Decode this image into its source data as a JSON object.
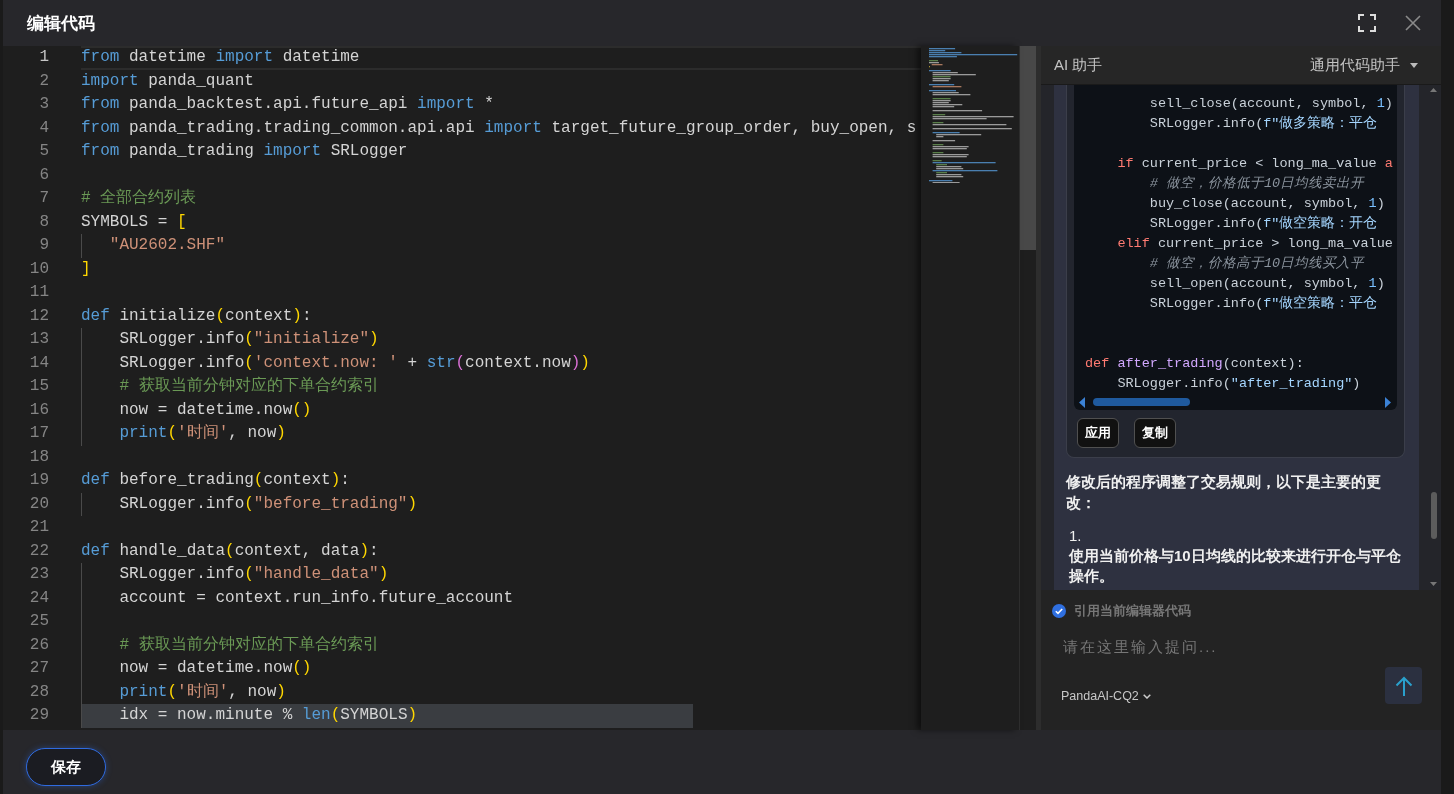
{
  "window": {
    "title": "编辑代码"
  },
  "editor": {
    "lines": [
      {
        "number": "1",
        "current": true,
        "selected": false,
        "indent_guide": false,
        "tokens": [
          {
            "kind": "keyword",
            "text": "from"
          },
          {
            "kind": "plain",
            "text": " datetime "
          },
          {
            "kind": "keyword",
            "text": "import"
          },
          {
            "kind": "plain",
            "text": " datetime"
          }
        ]
      },
      {
        "number": "2",
        "current": false,
        "selected": false,
        "indent_guide": false,
        "tokens": [
          {
            "kind": "keyword",
            "text": "import"
          },
          {
            "kind": "plain",
            "text": " panda_quant"
          }
        ]
      },
      {
        "number": "3",
        "current": false,
        "selected": false,
        "indent_guide": false,
        "tokens": [
          {
            "kind": "keyword",
            "text": "from"
          },
          {
            "kind": "plain",
            "text": " panda_backtest.api.future_api "
          },
          {
            "kind": "keyword",
            "text": "import"
          },
          {
            "kind": "plain",
            "text": " *"
          }
        ]
      },
      {
        "number": "4",
        "current": false,
        "selected": false,
        "indent_guide": false,
        "tokens": [
          {
            "kind": "keyword",
            "text": "from"
          },
          {
            "kind": "plain",
            "text": " panda_trading.trading_common.api.api "
          },
          {
            "kind": "keyword",
            "text": "import"
          },
          {
            "kind": "plain",
            "text": " target_future_group_order, buy_open, s"
          }
        ]
      },
      {
        "number": "5",
        "current": false,
        "selected": false,
        "indent_guide": false,
        "tokens": [
          {
            "kind": "keyword",
            "text": "from"
          },
          {
            "kind": "plain",
            "text": " panda_trading "
          },
          {
            "kind": "keyword",
            "text": "import"
          },
          {
            "kind": "plain",
            "text": " SRLogger"
          }
        ]
      },
      {
        "number": "6",
        "current": false,
        "selected": false,
        "indent_guide": false
      },
      {
        "number": "7",
        "current": false,
        "selected": false,
        "indent_guide": false,
        "tokens": [
          {
            "kind": "comment",
            "text": "# 全部合约列表"
          }
        ]
      },
      {
        "number": "8",
        "current": false,
        "selected": false,
        "indent_guide": false,
        "tokens": [
          {
            "kind": "plain",
            "text": "SYMBOLS = "
          },
          {
            "kind": "bracket",
            "text": "["
          }
        ]
      },
      {
        "number": "9",
        "current": false,
        "selected": false,
        "indent_guide": true,
        "tokens": [
          {
            "kind": "string",
            "text": "   \"AU2602.SHF\""
          }
        ]
      },
      {
        "number": "10",
        "current": false,
        "selected": false,
        "indent_guide": false,
        "tokens": [
          {
            "kind": "bracket",
            "text": "]"
          }
        ]
      },
      {
        "number": "11",
        "current": false,
        "selected": false,
        "indent_guide": false
      },
      {
        "number": "12",
        "current": false,
        "selected": false,
        "indent_guide": false,
        "tokens": [
          {
            "kind": "keyword",
            "text": "def"
          },
          {
            "kind": "plain",
            "text": " initialize"
          },
          {
            "kind": "bracket",
            "text": "("
          },
          {
            "kind": "plain",
            "text": "context"
          },
          {
            "kind": "bracket",
            "text": ")"
          },
          {
            "kind": "plain",
            "text": ":"
          }
        ]
      },
      {
        "number": "13",
        "current": false,
        "selected": false,
        "indent_guide": true,
        "tokens": [
          {
            "kind": "plain",
            "text": "    SRLogger.info"
          },
          {
            "kind": "bracket",
            "text": "("
          },
          {
            "kind": "string",
            "text": "\"initialize\""
          },
          {
            "kind": "bracket",
            "text": ")"
          }
        ]
      },
      {
        "number": "14",
        "current": false,
        "selected": false,
        "indent_guide": true,
        "tokens": [
          {
            "kind": "plain",
            "text": "    SRLogger.info"
          },
          {
            "kind": "bracket",
            "text": "("
          },
          {
            "kind": "string",
            "text": "'context.now: '"
          },
          {
            "kind": "plain",
            "text": " + "
          },
          {
            "kind": "keyword",
            "text": "str"
          },
          {
            "kind": "bracket_nested",
            "text": "("
          },
          {
            "kind": "plain",
            "text": "context.now"
          },
          {
            "kind": "bracket_nested",
            "text": ")"
          },
          {
            "kind": "bracket",
            "text": ")"
          }
        ]
      },
      {
        "number": "15",
        "current": false,
        "selected": false,
        "indent_guide": true,
        "tokens": [
          {
            "kind": "comment",
            "text": "    # 获取当前分钟对应的下单合约索引"
          }
        ]
      },
      {
        "number": "16",
        "current": false,
        "selected": false,
        "indent_guide": true,
        "tokens": [
          {
            "kind": "plain",
            "text": "    now = datetime.now"
          },
          {
            "kind": "bracket",
            "text": "()"
          }
        ]
      },
      {
        "number": "17",
        "current": false,
        "selected": false,
        "indent_guide": true,
        "tokens": [
          {
            "kind": "keyword",
            "text": "    print"
          },
          {
            "kind": "bracket",
            "text": "("
          },
          {
            "kind": "string",
            "text": "'时间'"
          },
          {
            "kind": "plain",
            "text": ", now"
          },
          {
            "kind": "bracket",
            "text": ")"
          }
        ]
      },
      {
        "number": "18",
        "current": false,
        "selected": false,
        "indent_guide": false
      },
      {
        "number": "19",
        "current": false,
        "selected": false,
        "indent_guide": false,
        "tokens": [
          {
            "kind": "keyword",
            "text": "def"
          },
          {
            "kind": "plain",
            "text": " before_trading"
          },
          {
            "kind": "bracket",
            "text": "("
          },
          {
            "kind": "plain",
            "text": "context"
          },
          {
            "kind": "bracket",
            "text": ")"
          },
          {
            "kind": "plain",
            "text": ":"
          }
        ]
      },
      {
        "number": "20",
        "current": false,
        "selected": false,
        "indent_guide": true,
        "tokens": [
          {
            "kind": "plain",
            "text": "    SRLogger.info"
          },
          {
            "kind": "bracket",
            "text": "("
          },
          {
            "kind": "string",
            "text": "\"before_trading\""
          },
          {
            "kind": "bracket",
            "text": ")"
          }
        ]
      },
      {
        "number": "21",
        "current": false,
        "selected": false,
        "indent_guide": false
      },
      {
        "number": "22",
        "current": false,
        "selected": false,
        "indent_guide": false,
        "tokens": [
          {
            "kind": "keyword",
            "text": "def"
          },
          {
            "kind": "plain",
            "text": " handle_data"
          },
          {
            "kind": "bracket",
            "text": "("
          },
          {
            "kind": "plain",
            "text": "context, data"
          },
          {
            "kind": "bracket",
            "text": ")"
          },
          {
            "kind": "plain",
            "text": ":"
          }
        ]
      },
      {
        "number": "23",
        "current": false,
        "selected": false,
        "indent_guide": true,
        "tokens": [
          {
            "kind": "plain",
            "text": "    SRLogger.info"
          },
          {
            "kind": "bracket",
            "text": "("
          },
          {
            "kind": "string",
            "text": "\"handle_data\""
          },
          {
            "kind": "bracket",
            "text": ")"
          }
        ]
      },
      {
        "number": "24",
        "current": false,
        "selected": false,
        "indent_guide": true,
        "tokens": [
          {
            "kind": "plain",
            "text": "    account = context.run_info.future_account"
          }
        ]
      },
      {
        "number": "25",
        "current": false,
        "selected": false,
        "indent_guide": true
      },
      {
        "number": "26",
        "current": false,
        "selected": false,
        "indent_guide": true,
        "tokens": [
          {
            "kind": "comment",
            "text": "    # 获取当前分钟对应的下单合约索引"
          }
        ]
      },
      {
        "number": "27",
        "current": false,
        "selected": false,
        "indent_guide": true,
        "tokens": [
          {
            "kind": "plain",
            "text": "    now = datetime.now"
          },
          {
            "kind": "bracket",
            "text": "()"
          }
        ]
      },
      {
        "number": "28",
        "current": false,
        "selected": false,
        "indent_guide": true,
        "tokens": [
          {
            "kind": "keyword",
            "text": "    print"
          },
          {
            "kind": "bracket",
            "text": "("
          },
          {
            "kind": "string",
            "text": "'时间'"
          },
          {
            "kind": "plain",
            "text": ", now"
          },
          {
            "kind": "bracket",
            "text": ")"
          }
        ]
      },
      {
        "number": "29",
        "current": false,
        "selected": true,
        "indent_guide": true,
        "tokens": [
          {
            "kind": "plain",
            "text": "    idx = now.minute % "
          },
          {
            "kind": "keyword",
            "text": "len"
          },
          {
            "kind": "bracket",
            "text": "("
          },
          {
            "kind": "plain",
            "text": "SYMBOLS"
          },
          {
            "kind": "bracket",
            "text": ")"
          }
        ]
      }
    ]
  },
  "assistant": {
    "title": "AI 助手",
    "mode": "通用代码助手",
    "code_block": {
      "lines": [
        {
          "kind": "code",
          "tokens": [
            {
              "kind": "plain",
              "text": "        sell_close(account, symbol, "
            },
            {
              "kind": "number",
              "text": "1"
            },
            {
              "kind": "plain",
              "text": ")"
            }
          ]
        },
        {
          "kind": "code",
          "tokens": [
            {
              "kind": "plain",
              "text": "        SRLogger.info("
            },
            {
              "kind": "string",
              "text": "f\"做多策略：平仓"
            }
          ]
        },
        {
          "kind": "blank"
        },
        {
          "kind": "code",
          "tokens": [
            {
              "kind": "keyword",
              "text": "    if"
            },
            {
              "kind": "plain",
              "text": " current_price < long_ma_value "
            },
            {
              "kind": "keyword",
              "text": "a"
            }
          ]
        },
        {
          "kind": "code",
          "tokens": [
            {
              "kind": "comment",
              "text": "        # 做空，价格低于10日均线卖出开"
            }
          ]
        },
        {
          "kind": "code",
          "tokens": [
            {
              "kind": "plain",
              "text": "        buy_close(account, symbol, "
            },
            {
              "kind": "number",
              "text": "1"
            },
            {
              "kind": "plain",
              "text": ")"
            }
          ]
        },
        {
          "kind": "code",
          "tokens": [
            {
              "kind": "plain",
              "text": "        SRLogger.info("
            },
            {
              "kind": "string",
              "text": "f\"做空策略：开仓"
            }
          ]
        },
        {
          "kind": "code",
          "tokens": [
            {
              "kind": "keyword",
              "text": "    elif"
            },
            {
              "kind": "plain",
              "text": " current_price > long_ma_value"
            }
          ]
        },
        {
          "kind": "code",
          "tokens": [
            {
              "kind": "comment",
              "text": "        # 做空，价格高于10日均线买入平"
            }
          ]
        },
        {
          "kind": "code",
          "tokens": [
            {
              "kind": "plain",
              "text": "        sell_open(account, symbol, "
            },
            {
              "kind": "number",
              "text": "1"
            },
            {
              "kind": "plain",
              "text": ")"
            }
          ]
        },
        {
          "kind": "code",
          "tokens": [
            {
              "kind": "plain",
              "text": "        SRLogger.info("
            },
            {
              "kind": "string",
              "text": "f\"做空策略：平仓"
            }
          ]
        },
        {
          "kind": "blank"
        },
        {
          "kind": "blank"
        },
        {
          "kind": "code",
          "tokens": [
            {
              "kind": "keyword",
              "text": "def "
            },
            {
              "kind": "function",
              "text": "after_trading"
            },
            {
              "kind": "plain",
              "text": "(context):"
            }
          ]
        },
        {
          "kind": "code",
          "tokens": [
            {
              "kind": "plain",
              "text": "    SRLogger.info("
            },
            {
              "kind": "string",
              "text": "\"after_trading\""
            },
            {
              "kind": "plain",
              "text": ")"
            }
          ]
        }
      ]
    },
    "code_actions": [
      "应用",
      "复制"
    ],
    "reply": {
      "text": "修改后的程序调整了交易规则，以下是主要的更改：",
      "list": [
        {
          "marker": "1.",
          "text": "使用当前价格与10日均线的比较来进行开仓与平仓操作。"
        }
      ]
    },
    "reference": {
      "label": "引用当前编辑器代码",
      "checked": true
    },
    "input": {
      "placeholder": "请在这里输入提问..."
    },
    "model": "PandaAI-CQ2"
  },
  "footer": {
    "save": "保存"
  }
}
